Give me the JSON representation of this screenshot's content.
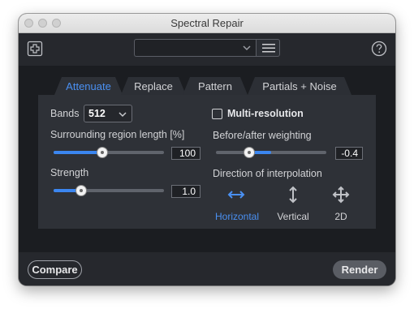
{
  "window": {
    "title": "Spectral Repair"
  },
  "toolbar": {
    "add_icon": "plus-square-icon",
    "preset_value": "",
    "menu_icon": "hamburger-icon",
    "help_icon": "question-circle-icon"
  },
  "tabs": [
    {
      "label": "Attenuate",
      "active": true
    },
    {
      "label": "Replace",
      "active": false
    },
    {
      "label": "Pattern",
      "active": false
    },
    {
      "label": "Partials + Noise",
      "active": false
    }
  ],
  "attenuate": {
    "bands_label": "Bands",
    "bands_value": "512",
    "surrounding_label": "Surrounding region length [%]",
    "surrounding_value": "100",
    "surrounding_fraction": 0.44,
    "strength_label": "Strength",
    "strength_value": "1.0",
    "strength_fraction": 0.25,
    "multires_label": "Multi-resolution",
    "multires_checked": false,
    "weighting_label": "Before/after weighting",
    "weighting_value": "-0.4",
    "weighting_fraction": 0.3,
    "direction_label": "Direction of interpolation",
    "directions": [
      {
        "label": "Horizontal",
        "icon": "horizontal-arrows-icon",
        "active": true
      },
      {
        "label": "Vertical",
        "icon": "vertical-arrows-icon",
        "active": false
      },
      {
        "label": "2D",
        "icon": "four-way-arrows-icon",
        "active": false
      }
    ]
  },
  "footer": {
    "compare_label": "Compare",
    "render_label": "Render"
  },
  "colors": {
    "accent": "#3b86f0",
    "panel_bg": "#2e3137",
    "window_bg": "#202226"
  }
}
